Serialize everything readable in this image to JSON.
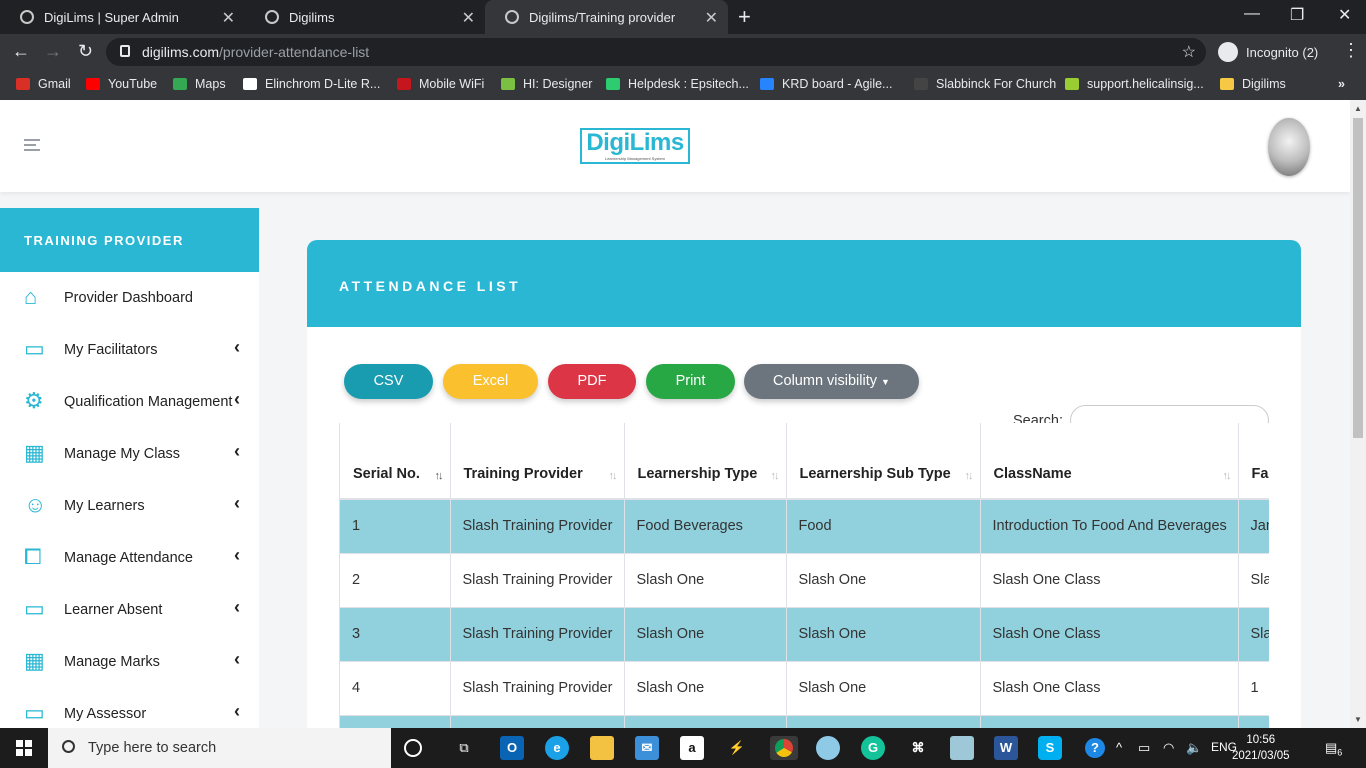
{
  "browser": {
    "tabs": [
      {
        "title": "DigiLims | Super Admin"
      },
      {
        "title": "Digilims"
      },
      {
        "title": "Digilims/Training provider"
      }
    ],
    "url_host": "digilims.com",
    "url_path": "/provider-attendance-list",
    "profile": "Incognito (2)",
    "bookmarks": [
      {
        "label": "Gmail",
        "color": "#d93025"
      },
      {
        "label": "YouTube",
        "color": "#ff0000"
      },
      {
        "label": "Maps",
        "color": "#34a853"
      },
      {
        "label": "Elinchrom D-Lite R...",
        "color": "#ffffff"
      },
      {
        "label": "Mobile WiFi",
        "color": "#c4161c"
      },
      {
        "label": "HI: Designer",
        "color": "#7bc043"
      },
      {
        "label": "Helpdesk : Epsitech...",
        "color": "#2ecc71"
      },
      {
        "label": "KRD board - Agile...",
        "color": "#2684ff"
      },
      {
        "label": "Slabbinck For Church",
        "color": "#444444"
      },
      {
        "label": "support.helicalinsig...",
        "color": "#9acd32"
      },
      {
        "label": "Digilims",
        "color": "#f6c945"
      }
    ]
  },
  "header": {
    "logo_text": "DigiLims",
    "logo_tagline": "Learnership Management System"
  },
  "sidebar": {
    "title": "TRAINING PROVIDER",
    "items": [
      {
        "label": "Provider Dashboard",
        "icon": "home-icon",
        "has_chevron": false
      },
      {
        "label": "My Facilitators",
        "icon": "laptop-icon",
        "has_chevron": true
      },
      {
        "label": "Qualification Management",
        "icon": "settings-window-icon",
        "has_chevron": true
      },
      {
        "label": "Manage My Class",
        "icon": "grid-icon",
        "has_chevron": true
      },
      {
        "label": "My Learners",
        "icon": "user-icon",
        "has_chevron": true
      },
      {
        "label": "Manage Attendance",
        "icon": "code-window-icon",
        "has_chevron": true
      },
      {
        "label": "Learner Absent",
        "icon": "laptop-icon",
        "has_chevron": true
      },
      {
        "label": "Manage Marks",
        "icon": "grid-icon",
        "has_chevron": true
      },
      {
        "label": "My Assessor",
        "icon": "monitor-icon",
        "has_chevron": true
      }
    ]
  },
  "main": {
    "card_title": "ATTENDANCE LIST",
    "buttons": [
      {
        "label": "CSV",
        "color": "#1a9cb0"
      },
      {
        "label": "Excel",
        "color": "#fbc02d"
      },
      {
        "label": "PDF",
        "color": "#dc3545"
      },
      {
        "label": "Print",
        "color": "#28a745"
      },
      {
        "label": "Column visibility",
        "color": "#6c757d"
      }
    ],
    "search_label": "Search:",
    "table": {
      "columns": [
        "Serial No.",
        "Training Provider",
        "Learnership Type",
        "Learnership Sub Type",
        "ClassName",
        "Facilitator"
      ],
      "rows": [
        [
          "1",
          "Slash Training Provider",
          "Food Beverages",
          "Food",
          "Introduction To Food And Beverages",
          "Jane"
        ],
        [
          "2",
          "Slash Training Provider",
          "Slash One",
          "Slash One",
          "Slash One Class",
          "Slash"
        ],
        [
          "3",
          "Slash Training Provider",
          "Slash One",
          "Slash One",
          "Slash One Class",
          "Slash"
        ],
        [
          "4",
          "Slash Training Provider",
          "Slash One",
          "Slash One",
          "Slash One Class",
          "1"
        ],
        [
          "",
          "",
          "",
          "",
          "",
          ""
        ]
      ]
    }
  },
  "taskbar": {
    "search_placeholder": "Type here to search",
    "language": "ENG",
    "time": "10:56",
    "date": "2021/03/05",
    "notifications": "6"
  },
  "colors": {
    "accent": "#29b7d3",
    "row_highlight": "#91d1dd"
  }
}
